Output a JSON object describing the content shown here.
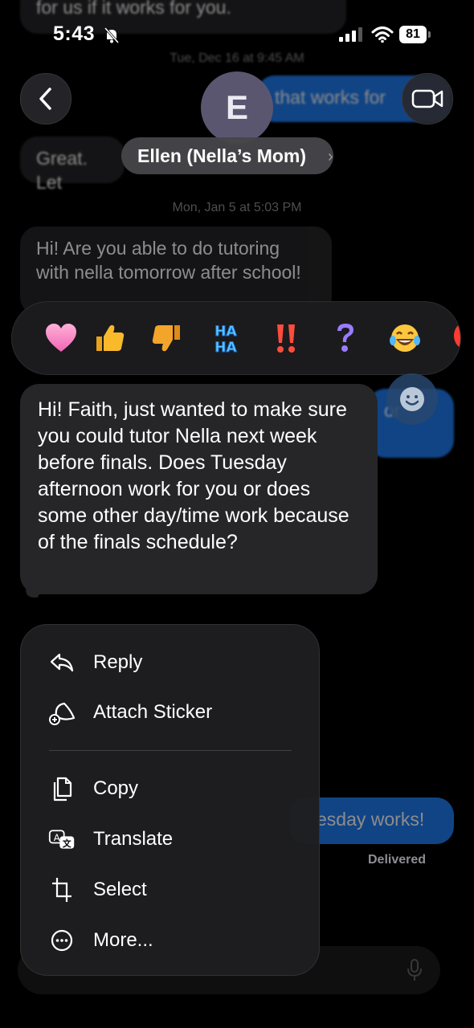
{
  "status_bar": {
    "time": "5:43",
    "battery": "81"
  },
  "header": {
    "avatar_initial": "E",
    "contact_name": "Ellen (Nella’s Mom)"
  },
  "conversation": {
    "top_partial_text": "for us if it works for you.",
    "timestamp_1": "Tue, Dec 16 at 9:45 AM",
    "outgoing_partial_1": "that works for",
    "incoming_partial_1": "Great. Let",
    "timestamp_2": "Mon, Jan 5 at 5:03 PM",
    "incoming_msg_2": "Hi! Are you able to do tutoring with nella tomorrow after school!",
    "outgoing_partial_2": "or",
    "outgoing_partial_3": "esday works!",
    "delivered": "Delivered"
  },
  "focused_message": "Hi! Faith, just wanted to make sure you could tutor Nella next week before finals. Does Tuesday afternoon work for you or does some other day/time work because of the finals schedule?",
  "reactions": [
    "heart",
    "thumbs-up",
    "thumbs-down",
    "haha",
    "double-exclamation",
    "question",
    "tears-of-joy",
    "balloon"
  ],
  "menu": {
    "reply": "Reply",
    "attach_sticker": "Attach Sticker",
    "copy": "Copy",
    "translate": "Translate",
    "select": "Select",
    "more": "More..."
  }
}
